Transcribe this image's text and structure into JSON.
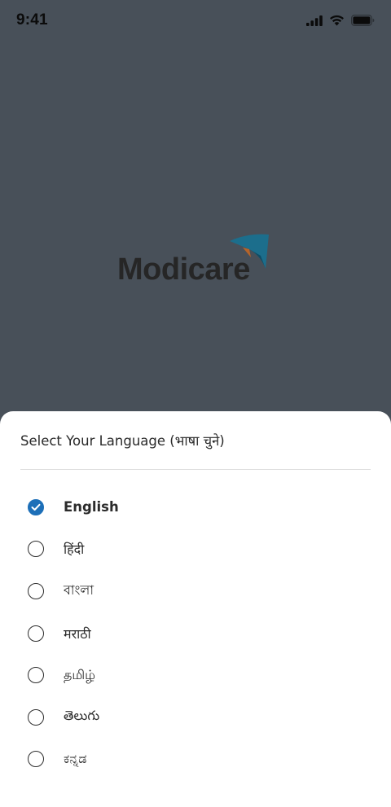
{
  "status_bar": {
    "time": "9:41",
    "icons": [
      "cellular-signal-icon",
      "wifi-icon",
      "battery-icon"
    ]
  },
  "splash": {
    "logo_text": "Modicare",
    "brand_colors": {
      "text": "#262626",
      "mark_blue": "#1c6e8c",
      "mark_orange": "#b5642a"
    }
  },
  "language_sheet": {
    "title": "Select Your Language (भाषा चुने)",
    "selected": "English",
    "options": [
      {
        "label": "English",
        "checked": true
      },
      {
        "label": "हिंदी",
        "checked": false
      },
      {
        "label": "বাংলা",
        "checked": false
      },
      {
        "label": "मराठी",
        "checked": false
      },
      {
        "label": "தமிழ்",
        "checked": false
      },
      {
        "label": "తెలుగు",
        "checked": false
      },
      {
        "label": "ಕನ್ನಡ",
        "checked": false
      }
    ],
    "accent_color": "#1d6fb8"
  }
}
